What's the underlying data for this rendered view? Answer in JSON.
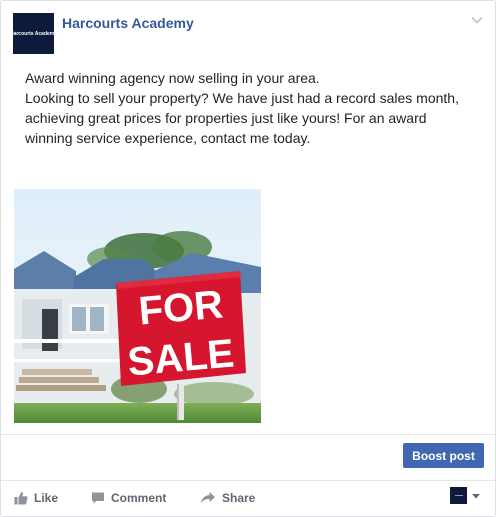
{
  "page": {
    "name": "Harcourts Academy",
    "logo_text": "Harcourts Academy"
  },
  "post": {
    "lines": [
      "Award winning agency now selling in your area.",
      "Looking to sell your property? We have just had a record sales month, achieving great prices for properties just like yours! For an award winning service experience, contact me today."
    ],
    "image": {
      "sign_line1": "FOR",
      "sign_line2": "SALE"
    }
  },
  "boost": {
    "label": "Boost post"
  },
  "actions": {
    "like": "Like",
    "comment": "Comment",
    "share": "Share"
  },
  "colors": {
    "link_blue": "#365899",
    "boost_blue": "#4267b2",
    "action_gray": "#606770",
    "sign_red": "#d6152e",
    "logo_navy": "#0e1a3c"
  },
  "icons": [
    "chevron-down-icon",
    "like-icon",
    "comment-icon",
    "share-icon",
    "caret-down-icon"
  ]
}
